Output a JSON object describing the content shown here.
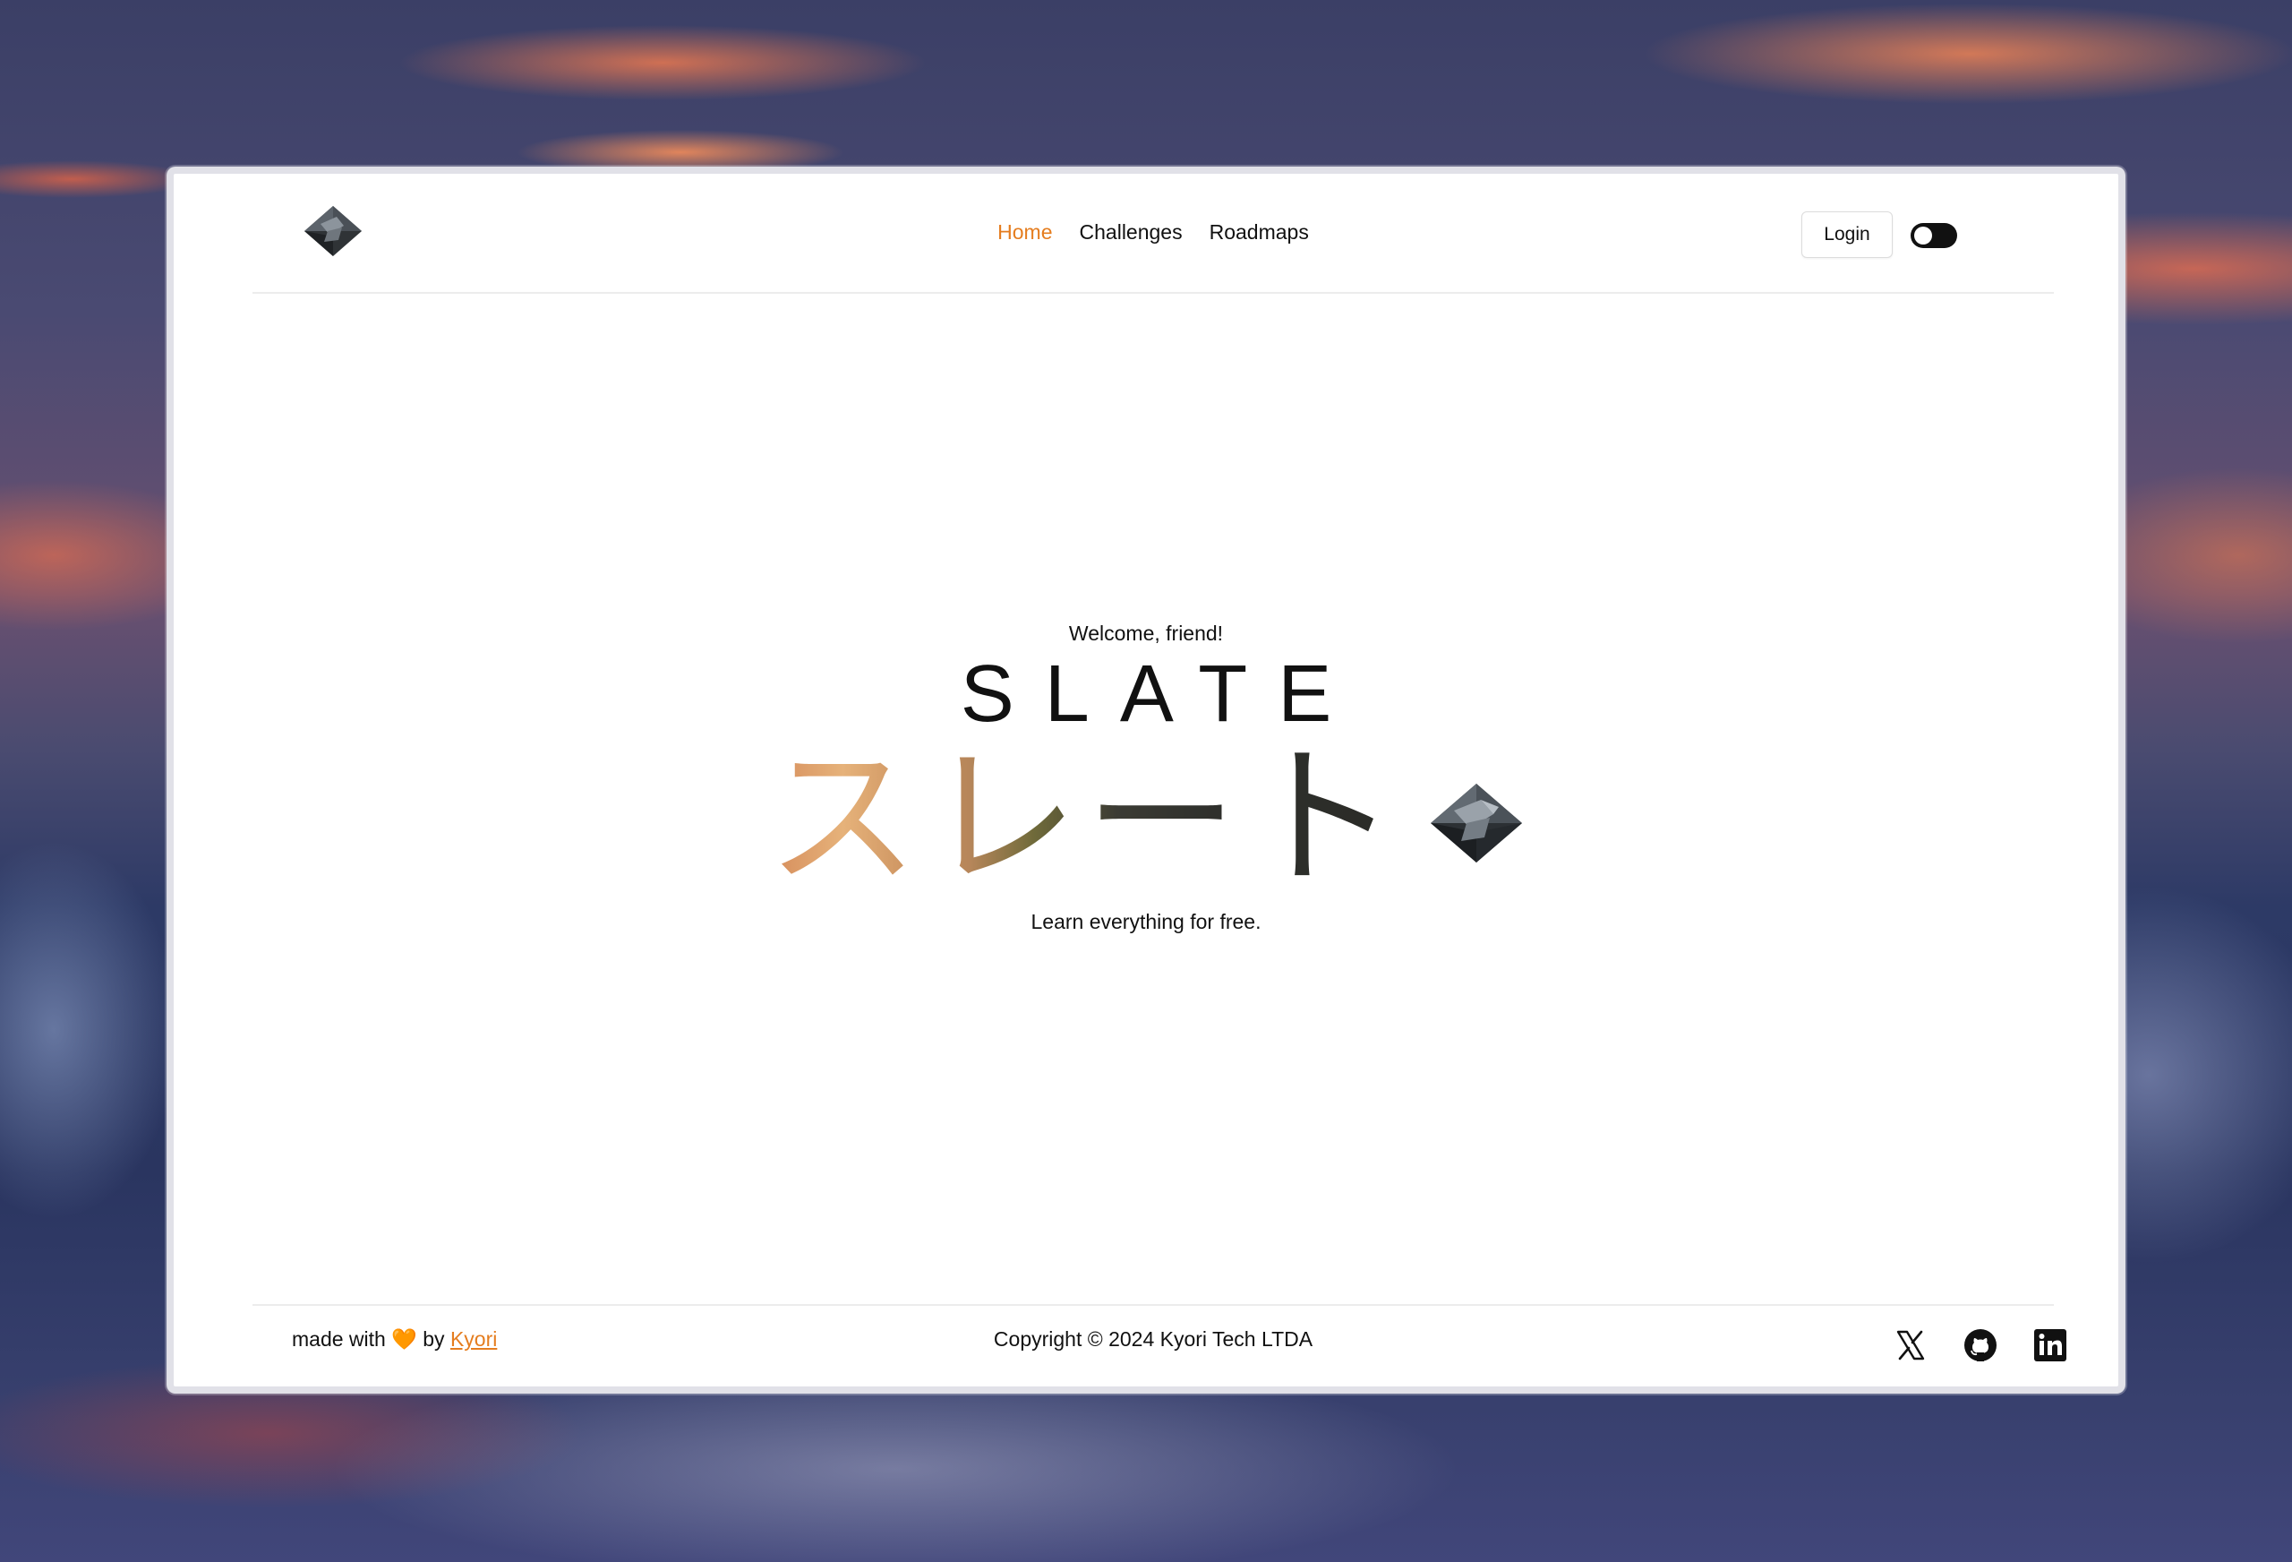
{
  "nav": {
    "items": [
      {
        "label": "Home",
        "active": true
      },
      {
        "label": "Challenges",
        "active": false
      },
      {
        "label": "Roadmaps",
        "active": false
      }
    ],
    "login_label": "Login",
    "theme_toggle": "dark-mode-toggle"
  },
  "hero": {
    "welcome": "Welcome, friend!",
    "title": "SLATE",
    "subtitle_japanese": "スレート",
    "tagline": "Learn everything for free."
  },
  "footer": {
    "made_with_prefix": "made with",
    "heart": "🧡",
    "by": "by",
    "author_link": "Kyori",
    "copyright": "Copyright © 2024 Kyori Tech LTDA",
    "socials": [
      "x-icon",
      "github-icon",
      "linkedin-icon"
    ]
  },
  "colors": {
    "accent": "#e57d1f",
    "text": "#111111",
    "background": "#ffffff"
  }
}
